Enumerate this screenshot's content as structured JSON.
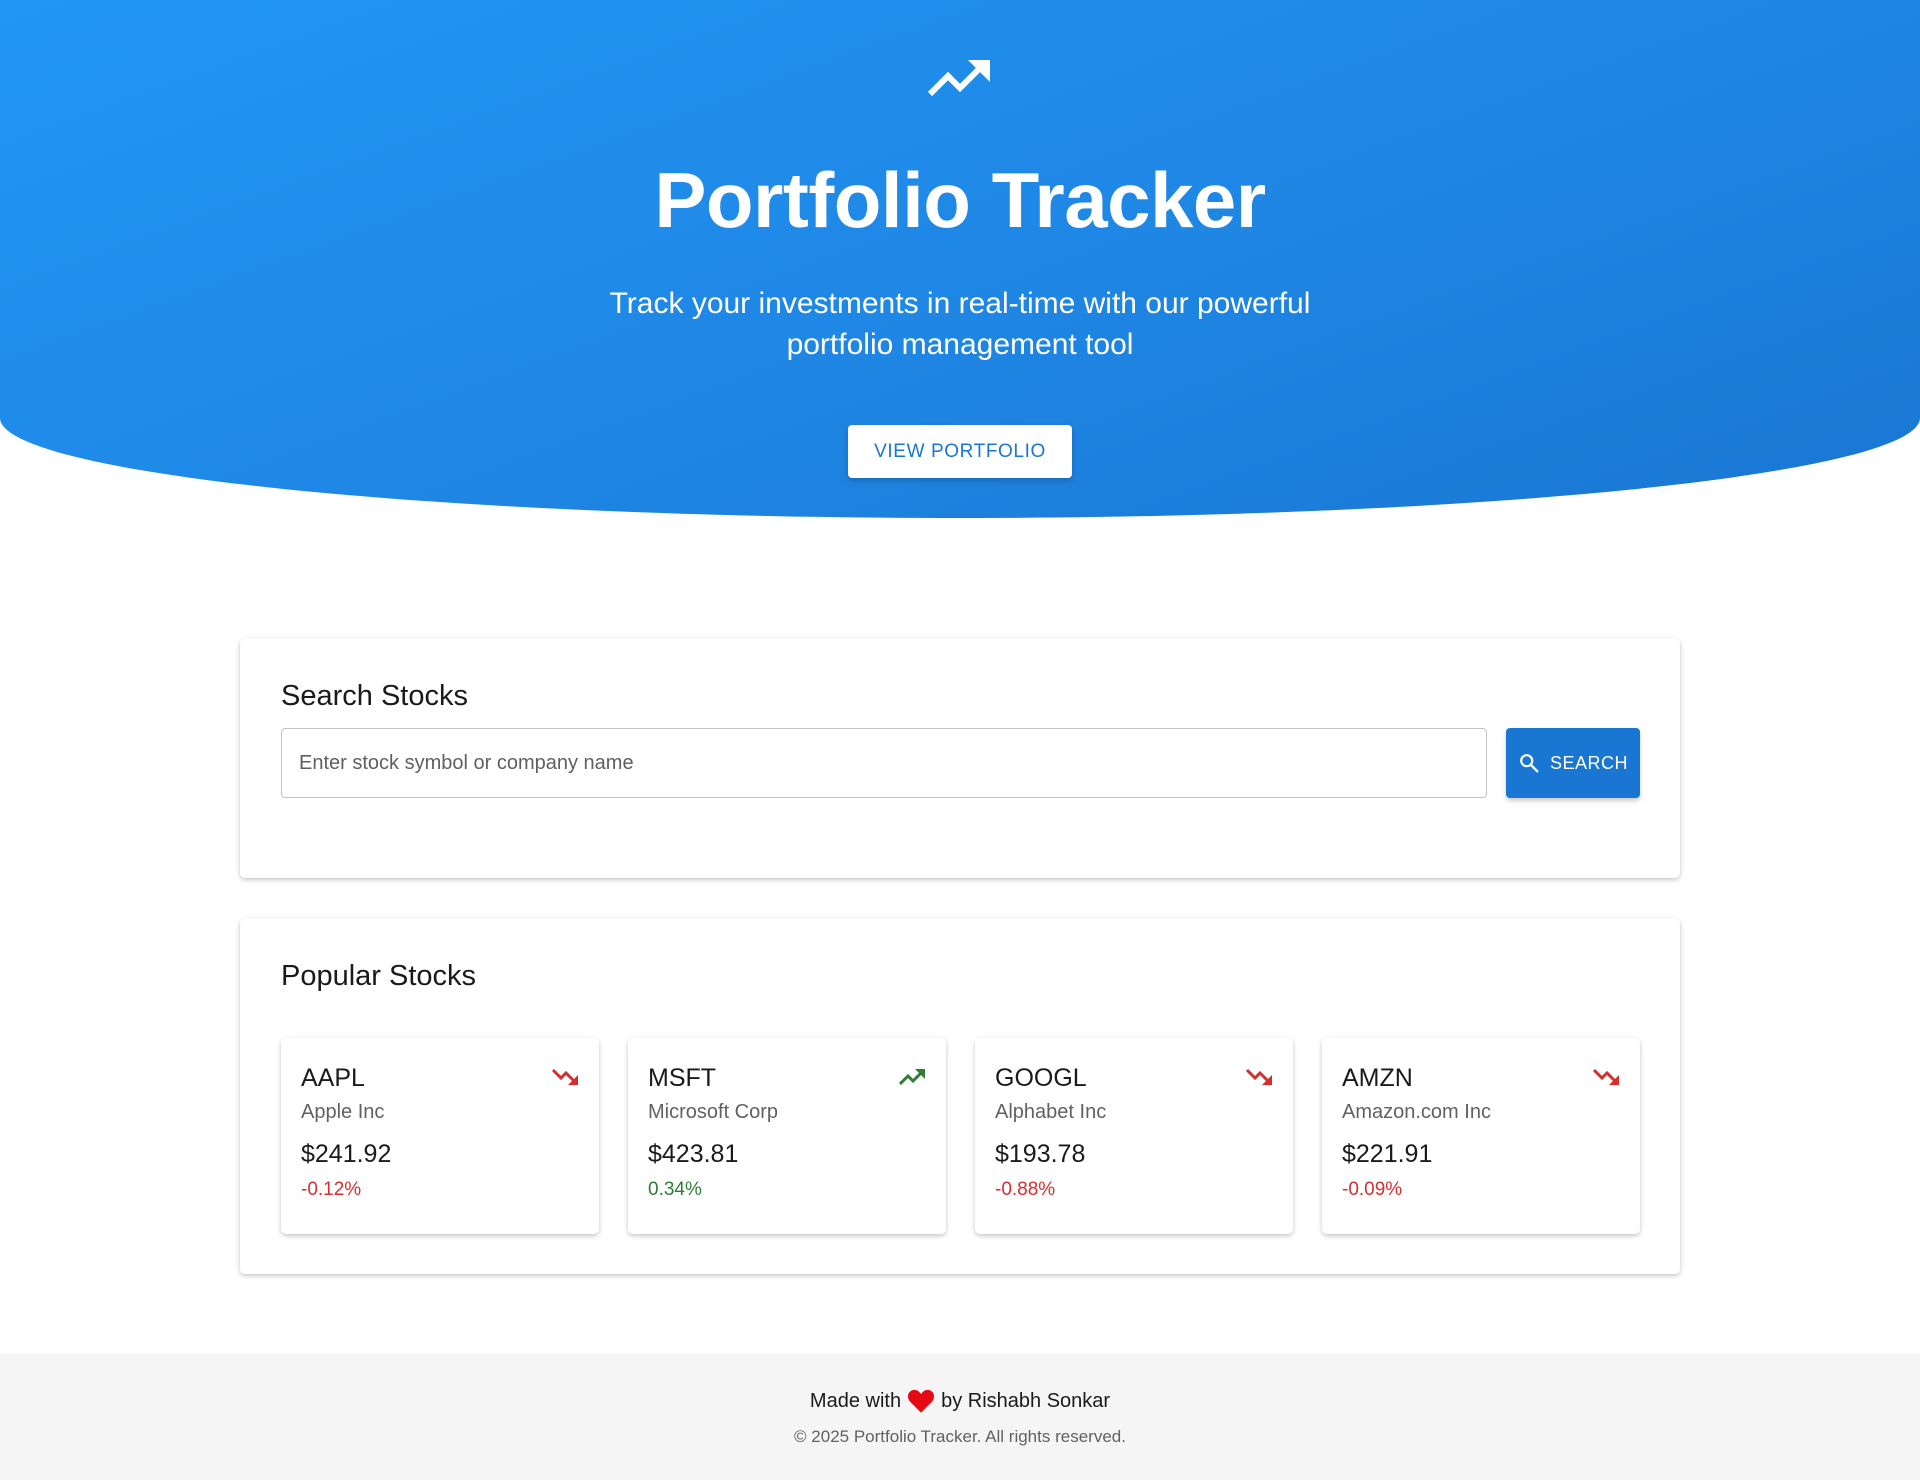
{
  "hero": {
    "icon": "trending-up-icon",
    "title": "Portfolio Tracker",
    "subtitle": "Track your investments in real-time with our powerful portfolio management tool",
    "button_label": "VIEW PORTFOLIO"
  },
  "search": {
    "title": "Search Stocks",
    "placeholder": "Enter stock symbol or company name",
    "value": "",
    "button_label": "SEARCH",
    "button_icon": "search-icon"
  },
  "popular": {
    "title": "Popular Stocks",
    "stocks": [
      {
        "symbol": "AAPL",
        "name": "Apple Inc",
        "price": "$241.92",
        "change": "-0.12%",
        "trend": "trending-down-icon"
      },
      {
        "symbol": "MSFT",
        "name": "Microsoft Corp",
        "price": "$423.81",
        "change": "0.34%",
        "trend": "trending-up-icon"
      },
      {
        "symbol": "GOOGL",
        "name": "Alphabet Inc",
        "price": "$193.78",
        "change": "-0.88%",
        "trend": "trending-down-icon"
      },
      {
        "symbol": "AMZN",
        "name": "Amazon.com Inc",
        "price": "$221.91",
        "change": "-0.09%",
        "trend": "trending-down-icon"
      }
    ]
  },
  "footer": {
    "made_with": "Made with",
    "by": "by Rishabh Sonkar",
    "heart_icon": "heart-icon",
    "copyright": "© 2025 Portfolio Tracker. All rights reserved."
  },
  "colors": {
    "primary": "#1976d2",
    "hero_gradient_start": "#2196f3",
    "negative": "#d32f2f",
    "positive": "#2e7d32",
    "heart": "#e50914",
    "footer_bg": "#f5f5f5"
  }
}
